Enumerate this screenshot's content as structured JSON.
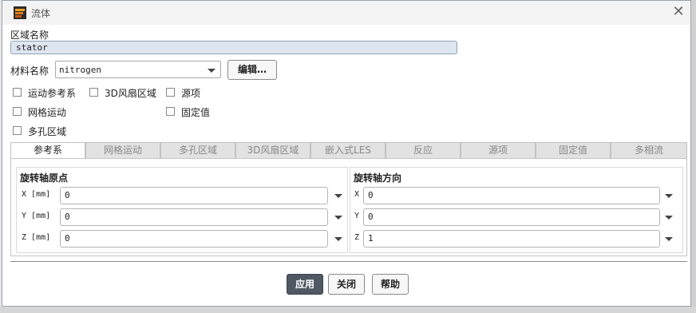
{
  "window": {
    "title": "流体",
    "close_icon": "close-icon"
  },
  "zone": {
    "label": "区域名称",
    "value": "stator"
  },
  "material": {
    "label": "材料名称",
    "value": "nitrogen",
    "edit_label": "编辑…"
  },
  "options": {
    "moving_reference": "运动参考系",
    "fan_zone_3d": "3D风扇区域",
    "source_terms": "源项",
    "mesh_motion": "网格运动",
    "fixed_values": "固定值",
    "porous_zone": "多孔区域"
  },
  "tabs": [
    "参考系",
    "网格运动",
    "多孔区域",
    "3D风扇区域",
    "嵌入式LES",
    "反应",
    "源项",
    "固定值",
    "多相流"
  ],
  "active_tab": "参考系",
  "origin": {
    "title": "旋转轴原点",
    "x_label": "X [mm]",
    "x_value": "0",
    "y_label": "Y [mm]",
    "y_value": "0",
    "z_label": "Z [mm]",
    "z_value": "0"
  },
  "direction": {
    "title": "旋转轴方向",
    "x_label": "X",
    "x_value": "0",
    "y_label": "Y",
    "y_value": "0",
    "z_label": "Z",
    "z_value": "1"
  },
  "footer": {
    "apply": "应用",
    "close": "关闭",
    "help": "帮助"
  },
  "colors": {
    "primary_button": "#4f5964",
    "zone_field": "#dde6f0"
  }
}
